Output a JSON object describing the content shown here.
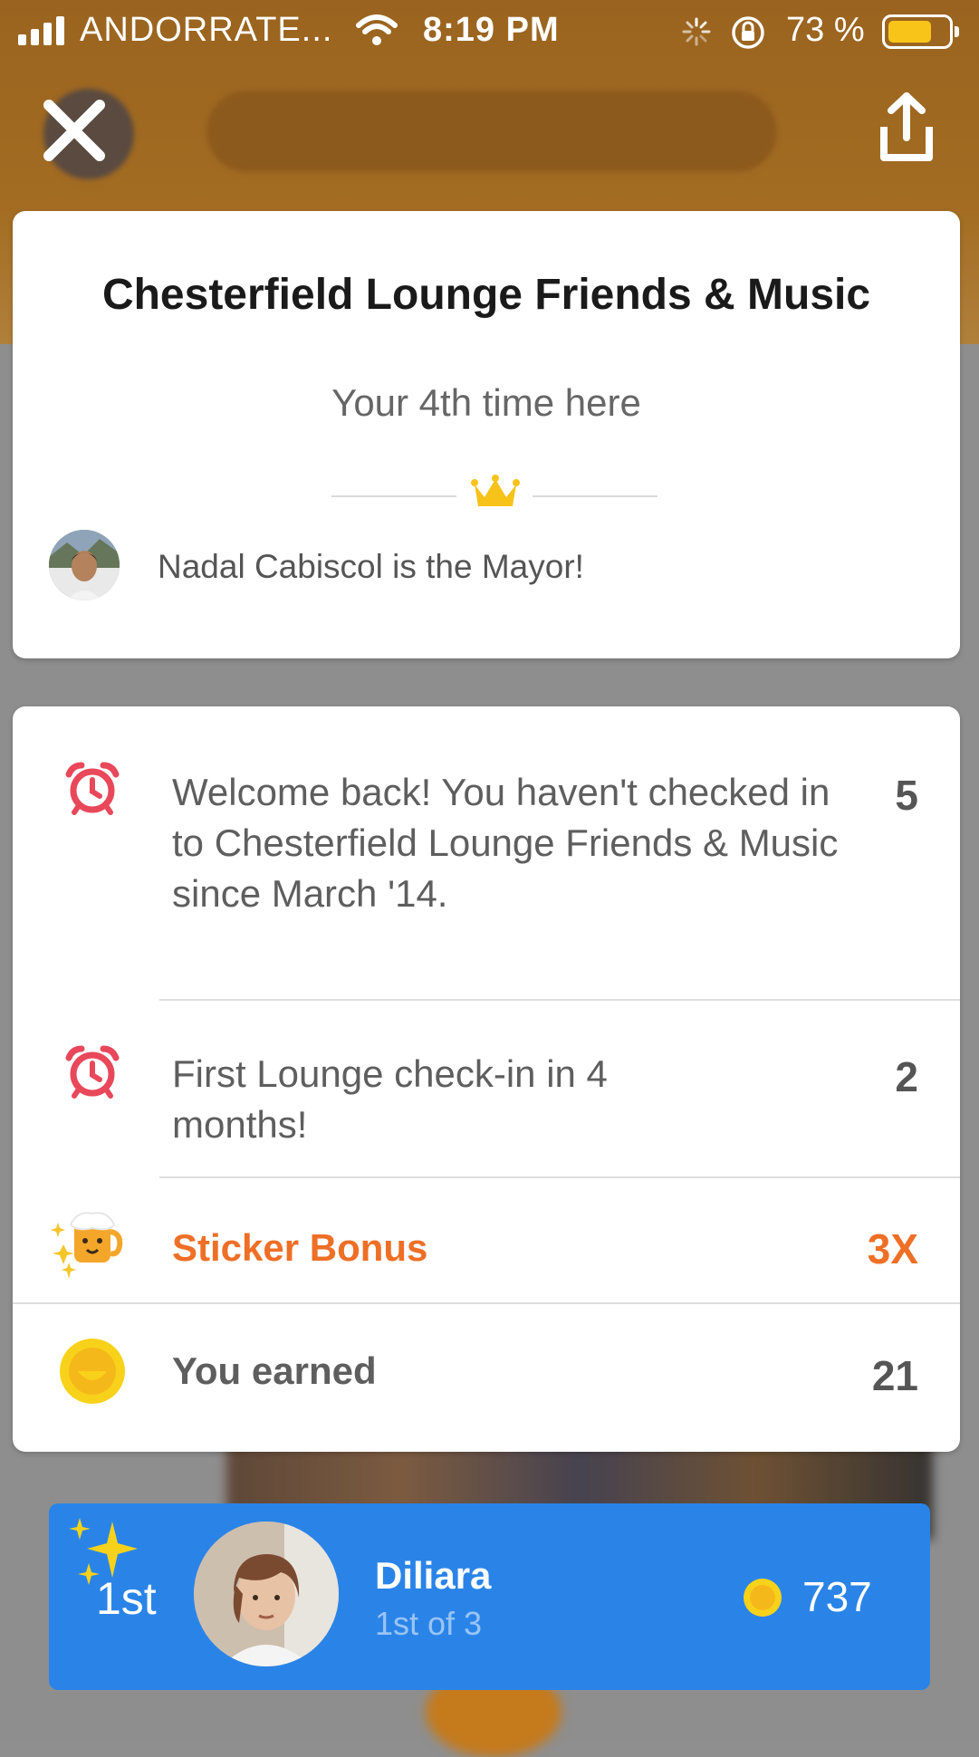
{
  "status_bar": {
    "carrier": "ANDORRATE...",
    "time": "8:19 PM",
    "battery": "73 %",
    "battery_level": 0.73
  },
  "venue": {
    "title": "Chesterfield Lounge Friends & Music",
    "visit": "Your 4th time here",
    "mayor": "Nadal Cabiscol is the Mayor!"
  },
  "points": {
    "rows": [
      {
        "icon": "alarm-clock-icon",
        "text": "Welcome back! You haven't checked in to Chesterfield Lounge Friends & Music since March '14.",
        "value": "5"
      },
      {
        "icon": "alarm-clock-icon",
        "text": "First Lounge check-in in 4 months!",
        "value": "2"
      },
      {
        "icon": "beer-sticker-icon",
        "text": "Sticker Bonus",
        "value": "3X"
      },
      {
        "icon": "coin-icon",
        "text": "You earned",
        "value": "21"
      }
    ]
  },
  "leaderboard": {
    "rank": "1st",
    "name": "Diliara",
    "subtitle": "1st of 3",
    "coins": "737"
  },
  "colors": {
    "accent_orange": "#ee6f26",
    "leader_blue": "#2a84e8",
    "header_brown": "#a36c22",
    "alarm_red": "#e8485a",
    "coin_yellow": "#f8c41a"
  }
}
